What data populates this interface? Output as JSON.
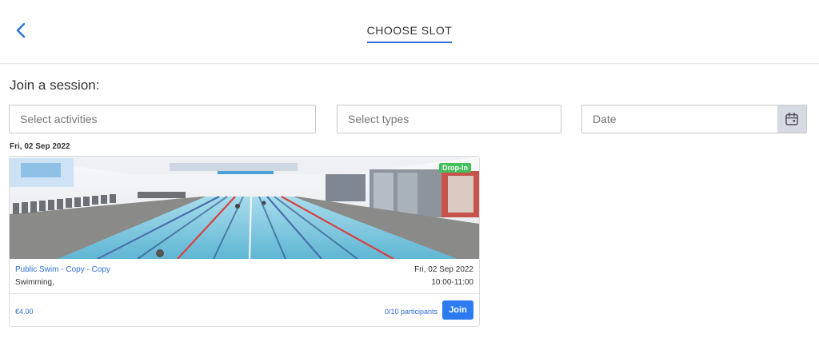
{
  "header": {
    "back_icon": "chevron-left-icon",
    "title": "CHOOSE SLOT",
    "accent_color": "#2d6fd6"
  },
  "filters": {
    "heading": "Join a session:",
    "activities_placeholder": "Select activities",
    "types_placeholder": "Select types",
    "date_placeholder": "Date",
    "calendar_icon": "calendar-icon"
  },
  "session_group": {
    "date_label": "Fri, 02 Sep 2022",
    "sessions": [
      {
        "badge": "Drop-In",
        "name": "Public Swim - Copy - Copy",
        "category": "Swimming,",
        "date": "Fri, 02 Sep 2022",
        "time": "10:00-11:00",
        "price": "€4.00",
        "participants": "0/10 participants",
        "join_label": "Join"
      }
    ]
  }
}
